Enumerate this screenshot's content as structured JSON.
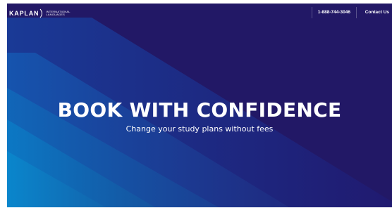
{
  "header": {
    "logo": {
      "wordmark": "KAPLAN",
      "sub_line_1": "INTERNATIONAL",
      "sub_line_2": "LANGUAGES"
    },
    "phone": "1-888-744-3046",
    "contact_label": "Contact Us"
  },
  "hero": {
    "title": "BOOK WITH CONFIDENCE",
    "subtitle": "Change your study plans without fees"
  },
  "colors": {
    "background_dark": "#221866",
    "stripe_light": "#0b7cc6",
    "text": "#ffffff"
  }
}
